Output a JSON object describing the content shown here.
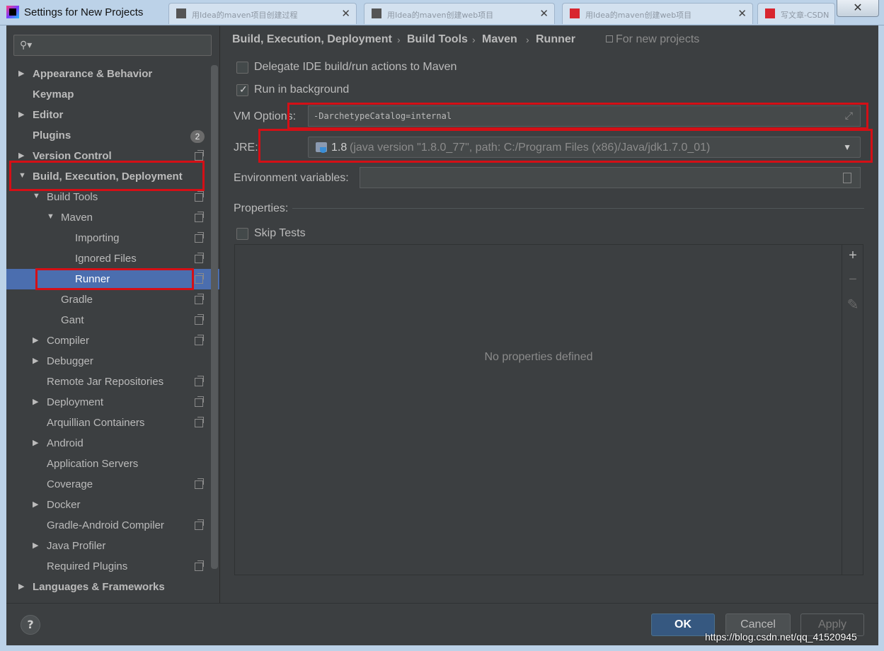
{
  "window": {
    "title": "Settings for New Projects",
    "close_glyph": "✕",
    "bg_tabs": [
      {
        "label": "用Idea的maven项目创建过程 博客 CSDN"
      },
      {
        "label": "用Idea的maven创建web项目 CSDN"
      },
      {
        "label": "用Idea的maven创建web项目 CSDN"
      },
      {
        "label": "写文章-CSDN"
      }
    ]
  },
  "search": {
    "icon_glyph": "⚲▾",
    "placeholder": ""
  },
  "tree": [
    {
      "label": "Appearance & Behavior",
      "bold": true,
      "arrow": "▶",
      "level": 0,
      "has_proj": false
    },
    {
      "label": "Keymap",
      "bold": true,
      "arrow": "",
      "level": 0,
      "has_proj": false
    },
    {
      "label": "Editor",
      "bold": true,
      "arrow": "▶",
      "level": 0,
      "has_proj": false
    },
    {
      "label": "Plugins",
      "bold": true,
      "arrow": "",
      "level": 0,
      "has_proj": false,
      "badge": "2"
    },
    {
      "label": "Version Control",
      "bold": true,
      "arrow": "▶",
      "level": 0,
      "has_proj": true
    },
    {
      "label": "Build, Execution, Deployment",
      "bold": true,
      "arrow": "▼",
      "level": 0,
      "has_proj": false
    },
    {
      "label": "Build Tools",
      "bold": false,
      "arrow": "▼",
      "level": 1,
      "has_proj": true
    },
    {
      "label": "Maven",
      "bold": false,
      "arrow": "▼",
      "level": 2,
      "has_proj": true
    },
    {
      "label": "Importing",
      "bold": false,
      "arrow": "",
      "level": 3,
      "has_proj": true
    },
    {
      "label": "Ignored Files",
      "bold": false,
      "arrow": "",
      "level": 3,
      "has_proj": true
    },
    {
      "label": "Runner",
      "bold": false,
      "arrow": "",
      "level": 3,
      "has_proj": true,
      "selected": true
    },
    {
      "label": "Gradle",
      "bold": false,
      "arrow": "",
      "level": 2,
      "has_proj": true
    },
    {
      "label": "Gant",
      "bold": false,
      "arrow": "",
      "level": 2,
      "has_proj": true
    },
    {
      "label": "Compiler",
      "bold": false,
      "arrow": "▶",
      "level": 1,
      "has_proj": true
    },
    {
      "label": "Debugger",
      "bold": false,
      "arrow": "▶",
      "level": 1,
      "has_proj": false
    },
    {
      "label": "Remote Jar Repositories",
      "bold": false,
      "arrow": "",
      "level": 1,
      "has_proj": true
    },
    {
      "label": "Deployment",
      "bold": false,
      "arrow": "▶",
      "level": 1,
      "has_proj": true
    },
    {
      "label": "Arquillian Containers",
      "bold": false,
      "arrow": "",
      "level": 1,
      "has_proj": true
    },
    {
      "label": "Android",
      "bold": false,
      "arrow": "▶",
      "level": 1,
      "has_proj": false
    },
    {
      "label": "Application Servers",
      "bold": false,
      "arrow": "",
      "level": 1,
      "has_proj": false
    },
    {
      "label": "Coverage",
      "bold": false,
      "arrow": "",
      "level": 1,
      "has_proj": true
    },
    {
      "label": "Docker",
      "bold": false,
      "arrow": "▶",
      "level": 1,
      "has_proj": false
    },
    {
      "label": "Gradle-Android Compiler",
      "bold": false,
      "arrow": "",
      "level": 1,
      "has_proj": true
    },
    {
      "label": "Java Profiler",
      "bold": false,
      "arrow": "▶",
      "level": 1,
      "has_proj": false
    },
    {
      "label": "Required Plugins",
      "bold": false,
      "arrow": "",
      "level": 1,
      "has_proj": true
    },
    {
      "label": "Languages & Frameworks",
      "bold": true,
      "arrow": "▶",
      "level": 0,
      "has_proj": false
    }
  ],
  "breadcrumb": {
    "items": [
      "Build, Execution, Deployment",
      "Build Tools",
      "Maven",
      "Runner"
    ],
    "separator": "›",
    "for_new": "For new projects"
  },
  "runner": {
    "delegate_label": "Delegate IDE build/run actions to Maven",
    "delegate_checked": false,
    "background_label": "Run in background",
    "background_checked": true,
    "check_glyph": "✓",
    "vm_label": "VM Options:",
    "vm_value": "-DarchetypeCatalog=internal",
    "expand_glyph": "⤢",
    "jre_label": "JRE:",
    "jre_version": "1.8",
    "jre_detail": "(java version \"1.8.0_77\", path: C:/Program Files (x86)/Java/jdk1.7.0_01)",
    "combo_arrow": "▼",
    "env_label": "Environment variables:",
    "env_value": "",
    "properties_label": "Properties:",
    "skip_label": "Skip Tests",
    "skip_checked": false,
    "empty_text": "No properties defined",
    "add_glyph": "+",
    "remove_glyph": "−",
    "edit_glyph": "✎"
  },
  "footer": {
    "help_glyph": "?",
    "ok": "OK",
    "cancel": "Cancel",
    "apply": "Apply"
  },
  "watermark": "https://blog.csdn.net/qq_41520945",
  "colors": {
    "background": "#3c3f41",
    "selection": "#4b6eaf",
    "ok_button": "#365880",
    "highlight": "#d40f16"
  }
}
